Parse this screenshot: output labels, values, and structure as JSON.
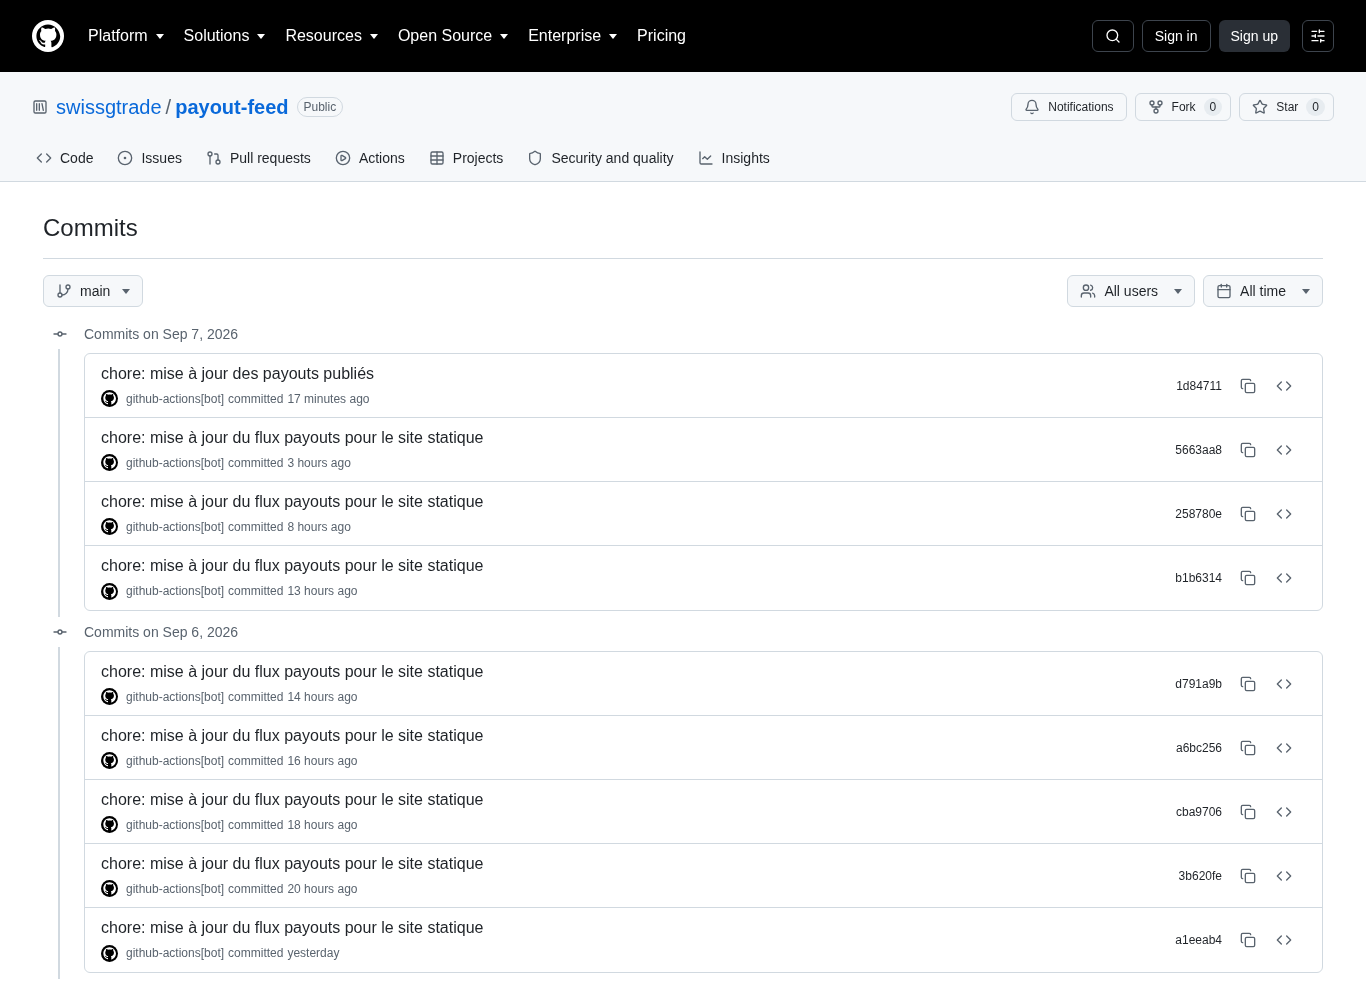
{
  "top_nav": [
    {
      "label": "Platform",
      "menu": true
    },
    {
      "label": "Solutions",
      "menu": true
    },
    {
      "label": "Resources",
      "menu": true
    },
    {
      "label": "Open Source",
      "menu": true
    },
    {
      "label": "Enterprise",
      "menu": true
    },
    {
      "label": "Pricing",
      "menu": false
    }
  ],
  "auth": {
    "sign_in": "Sign in",
    "sign_up": "Sign up"
  },
  "repo": {
    "owner": "swissgtrade",
    "separator": "/",
    "name": "payout-feed",
    "visibility": "Public"
  },
  "repo_actions": {
    "notifications": "Notifications",
    "fork": "Fork",
    "fork_count": "0",
    "star": "Star",
    "star_count": "0"
  },
  "tabs": [
    {
      "label": "Code",
      "kind": "code",
      "selected": false
    },
    {
      "label": "Issues",
      "kind": "issues",
      "selected": false
    },
    {
      "label": "Pull requests",
      "kind": "pulls",
      "selected": false
    },
    {
      "label": "Actions",
      "kind": "actions",
      "selected": false
    },
    {
      "label": "Projects",
      "kind": "projects",
      "selected": false
    },
    {
      "label": "Security and quality",
      "kind": "security",
      "selected": false
    },
    {
      "label": "Insights",
      "kind": "insights",
      "selected": false
    }
  ],
  "page_title": "Commits",
  "branch": "main",
  "filters": {
    "users": "All users",
    "time": "All time"
  },
  "groups": [
    {
      "heading": "Commits on Sep 7, 2026",
      "commits": [
        {
          "message": "chore: mise à jour des payouts publiés",
          "author": "github-actions[bot]",
          "verb": "committed",
          "time": "17 minutes ago",
          "sha": "1d84711"
        },
        {
          "message": "chore: mise à jour du flux payouts pour le site statique",
          "author": "github-actions[bot]",
          "verb": "committed",
          "time": "3 hours ago",
          "sha": "5663aa8"
        },
        {
          "message": "chore: mise à jour du flux payouts pour le site statique",
          "author": "github-actions[bot]",
          "verb": "committed",
          "time": "8 hours ago",
          "sha": "258780e"
        },
        {
          "message": "chore: mise à jour du flux payouts pour le site statique",
          "author": "github-actions[bot]",
          "verb": "committed",
          "time": "13 hours ago",
          "sha": "b1b6314"
        }
      ]
    },
    {
      "heading": "Commits on Sep 6, 2026",
      "commits": [
        {
          "message": "chore: mise à jour du flux payouts pour le site statique",
          "author": "github-actions[bot]",
          "verb": "committed",
          "time": "14 hours ago",
          "sha": "d791a9b"
        },
        {
          "message": "chore: mise à jour du flux payouts pour le site statique",
          "author": "github-actions[bot]",
          "verb": "committed",
          "time": "16 hours ago",
          "sha": "a6bc256"
        },
        {
          "message": "chore: mise à jour du flux payouts pour le site statique",
          "author": "github-actions[bot]",
          "verb": "committed",
          "time": "18 hours ago",
          "sha": "cba9706"
        },
        {
          "message": "chore: mise à jour du flux payouts pour le site statique",
          "author": "github-actions[bot]",
          "verb": "committed",
          "time": "20 hours ago",
          "sha": "3b620fe"
        },
        {
          "message": "chore: mise à jour du flux payouts pour le site statique",
          "author": "github-actions[bot]",
          "verb": "committed",
          "time": "yesterday",
          "sha": "a1eeab4"
        }
      ]
    }
  ]
}
